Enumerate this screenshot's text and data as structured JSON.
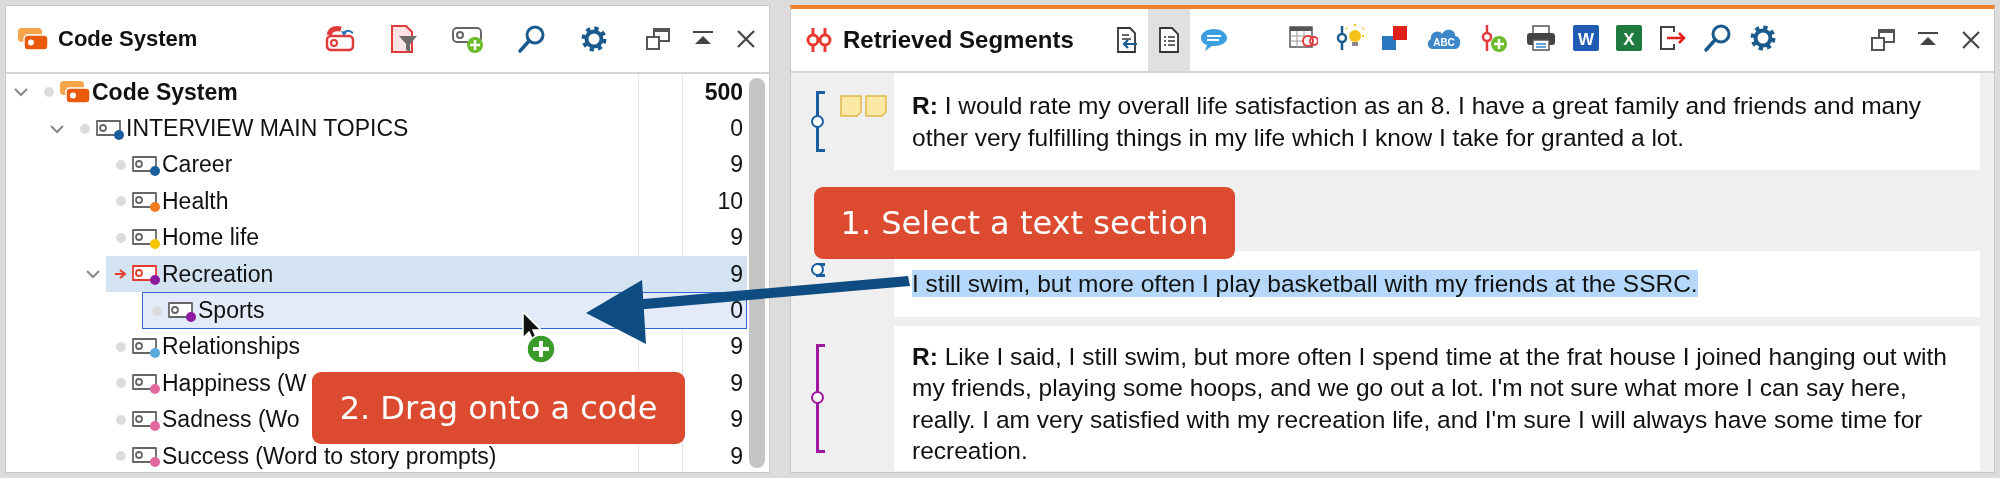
{
  "code_system": {
    "title": "Code System",
    "tree": [
      {
        "kind": "root",
        "label": "Code System",
        "count": "500",
        "expanded": true,
        "activated": false,
        "selected": false,
        "drop_target": false,
        "children": [
          {
            "kind": "code",
            "label": "INTERVIEW MAIN TOPICS",
            "count": "0",
            "color": "#1a5e9e",
            "expanded": true,
            "activated": false,
            "selected": false,
            "drop_target": false,
            "children": [
              {
                "kind": "code",
                "label": "Career",
                "count": "9",
                "color": "#1a5e9e",
                "activated": false,
                "selected": false,
                "drop_target": false
              },
              {
                "kind": "code",
                "label": "Health",
                "count": "10",
                "color": "#f27a1f",
                "activated": false,
                "selected": false,
                "drop_target": false
              },
              {
                "kind": "code",
                "label": "Home life",
                "count": "9",
                "color": "#f5c400",
                "activated": false,
                "selected": false,
                "drop_target": false
              },
              {
                "kind": "code",
                "label": "Recreation",
                "count": "9",
                "color": "#8e1a9e",
                "expanded": true,
                "activated": true,
                "selected": true,
                "drop_target": false,
                "children": [
                  {
                    "kind": "code",
                    "label": "Sports",
                    "count": "0",
                    "color": "#8e1a9e",
                    "activated": false,
                    "selected": false,
                    "drop_target": true
                  }
                ]
              },
              {
                "kind": "code",
                "label": "Relationships",
                "count": "9",
                "color": "#5aa9dd",
                "activated": false,
                "selected": false,
                "drop_target": false
              },
              {
                "kind": "code",
                "label": "Happiness (W",
                "count": "9",
                "color": "#e2679e",
                "activated": false,
                "selected": false,
                "drop_target": false
              },
              {
                "kind": "code",
                "label": "Sadness (Wo",
                "count": "9",
                "color": "#e2679e",
                "activated": false,
                "selected": false,
                "drop_target": false
              },
              {
                "kind": "code",
                "label": "Success (Word to story prompts)",
                "count": "9",
                "color": "#e2679e",
                "activated": false,
                "selected": false,
                "drop_target": false
              }
            ]
          }
        ]
      }
    ]
  },
  "retrieved_segments": {
    "title": "Retrieved Segments",
    "view_buttons": [
      {
        "kind": "import",
        "selected": false
      },
      {
        "kind": "list",
        "selected": true
      },
      {
        "kind": "comment",
        "selected": false
      }
    ],
    "tools": [
      {
        "kind": "matrix"
      },
      {
        "kind": "idea"
      },
      {
        "kind": "squares"
      },
      {
        "kind": "cloud",
        "label": "ABC"
      },
      {
        "kind": "code-add"
      },
      {
        "kind": "print"
      },
      {
        "kind": "word",
        "label": "W"
      },
      {
        "kind": "excel",
        "label": "X"
      },
      {
        "kind": "export"
      },
      {
        "kind": "search"
      },
      {
        "kind": "settings"
      }
    ],
    "segments": [
      {
        "text": "**R:** I would rate my overall life satisfaction as an 8. I have a great family and friends and many other very fulfilling things in my life which I know I take for granted a lot.",
        "color": "#1a5e9e",
        "has_memo": true,
        "selected": false
      },
      {
        "text": "I still swim, but more often I play basketball with my friends at the SSRC.",
        "color": "#1a5e9e",
        "has_memo": false,
        "selected": true
      },
      {
        "text": "**R:** Like I said, I still swim, but more often I spend time at the frat house I joined hanging out with my friends, playing some hoops, and we go out a lot. I'm not sure what more I can say here, really. I am very satisfied with my recreation life, and I'm sure I will always have some time for recreation.",
        "color": "#a0169e",
        "has_memo": false,
        "selected": false
      }
    ]
  },
  "annotations": [
    {
      "text": "1. Select a text section"
    },
    {
      "text": "2. Drag onto a code"
    }
  ]
}
